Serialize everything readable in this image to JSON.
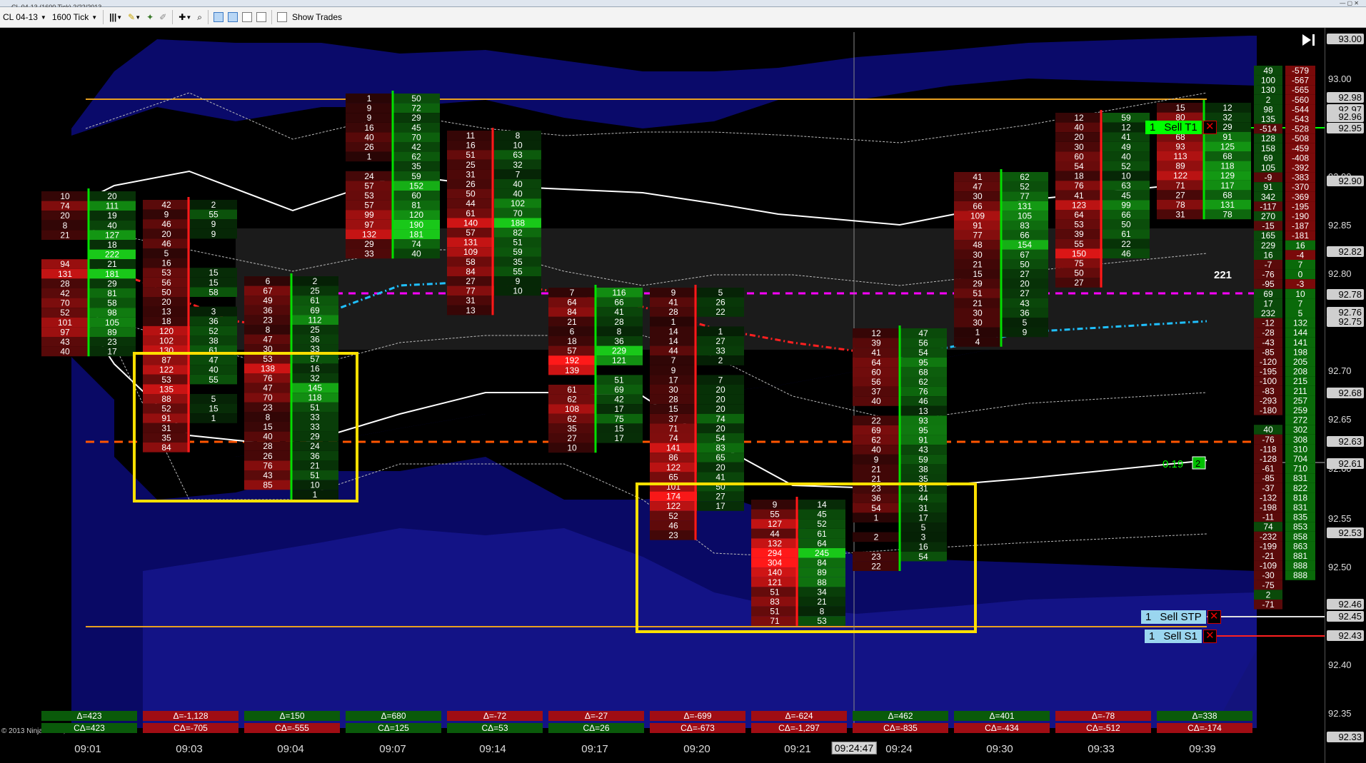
{
  "window": {
    "title": "CL 04-13 (1600 Tick)  2/22/2013"
  },
  "toolbar": {
    "instrument": "CL 04-13",
    "period": "1600 Tick",
    "show_trades": "Show Trades"
  },
  "colors": {
    "bg": "#000000",
    "buy": "#00c000",
    "sell": "#ff2020",
    "band": "#101070",
    "highlight": "#ffe000"
  },
  "price_axis": {
    "ticks": [
      "93.00",
      "92.95",
      "92.90",
      "92.85",
      "92.80",
      "92.75",
      "92.70",
      "92.65",
      "92.60",
      "92.55",
      "92.50",
      "92.45",
      "92.40",
      "92.35"
    ],
    "labels": [
      "93.00",
      "92.98",
      "92.97",
      "92.96",
      "92.95",
      "92.90",
      "92.82",
      "92.78",
      "92.76",
      "92.75",
      "92.68",
      "92.63",
      "92.61",
      "92.53",
      "92.46",
      "92.45",
      "92.43",
      "92.33"
    ]
  },
  "time_axis": {
    "labels": [
      "09:01",
      "09:03",
      "09:04",
      "09:07",
      "09:14",
      "09:17",
      "09:20",
      "09:21",
      "09:24",
      "09:30",
      "09:33",
      "09:39"
    ],
    "cursor": "09:24:47"
  },
  "copyright": "© 2013 NinjaTrader, LLC",
  "deltas": [
    {
      "d": "Δ=423",
      "cd": "CΔ=423",
      "pos": true,
      "cpos": true
    },
    {
      "d": "Δ=-1,128",
      "cd": "CΔ=-705",
      "pos": false,
      "cpos": false
    },
    {
      "d": "Δ=150",
      "cd": "CΔ=-555",
      "pos": true,
      "cpos": false
    },
    {
      "d": "Δ=680",
      "cd": "CΔ=125",
      "pos": true,
      "cpos": true
    },
    {
      "d": "Δ=-72",
      "cd": "CΔ=53",
      "pos": false,
      "cpos": true
    },
    {
      "d": "Δ=-27",
      "cd": "CΔ=26",
      "pos": false,
      "cpos": true
    },
    {
      "d": "Δ=-699",
      "cd": "CΔ=-673",
      "pos": false,
      "cpos": false
    },
    {
      "d": "Δ=-624",
      "cd": "CΔ=-1,297",
      "pos": false,
      "cpos": false
    },
    {
      "d": "Δ=462",
      "cd": "CΔ=-835",
      "pos": true,
      "cpos": false
    },
    {
      "d": "Δ=401",
      "cd": "CΔ=-434",
      "pos": true,
      "cpos": false
    },
    {
      "d": "Δ=-78",
      "cd": "CΔ=-512",
      "pos": false,
      "cpos": false
    },
    {
      "d": "Δ=338",
      "cd": "CΔ=-174",
      "pos": true,
      "cpos": false
    }
  ],
  "orders": {
    "target": {
      "qty": "1",
      "label": "Sell T1"
    },
    "stop": {
      "qty": "1",
      "label": "Sell STP"
    },
    "s1": {
      "qty": "1",
      "label": "Sell S1"
    }
  },
  "position_pnl": "0.19",
  "position_qty": "2",
  "volume_note": "221",
  "bars": [
    {
      "bid": [
        "10",
        "74",
        "20",
        "8",
        "21",
        "",
        "",
        "94",
        "131",
        "28",
        "42",
        "70",
        "52",
        "101",
        "97",
        "43",
        "40"
      ],
      "ask": [
        "20",
        "111",
        "19",
        "40",
        "127",
        "18",
        "222",
        "21",
        "181",
        "29",
        "81",
        "58",
        "98",
        "105",
        "89",
        "23",
        "17"
      ]
    },
    {
      "bid": [
        "42",
        "9",
        "46",
        "20",
        "46",
        "5",
        "16",
        "53",
        "56",
        "50",
        "20",
        "13",
        "18",
        "120",
        "102",
        "130",
        "87",
        "122",
        "53",
        "135",
        "88",
        "52",
        "91",
        "31",
        "35",
        "84"
      ],
      "ask": [
        "2",
        "55",
        "9",
        "9",
        "",
        "",
        "",
        "15",
        "15",
        "58",
        "",
        "3",
        "36",
        "52",
        "38",
        "61",
        "47",
        "40",
        "55",
        "",
        "5",
        "15",
        "1"
      ]
    },
    {
      "bid": [
        "6",
        "67",
        "49",
        "36",
        "23",
        "8",
        "47",
        "30",
        "53",
        "138",
        "76",
        "47",
        "70",
        "23",
        "8",
        "15",
        "40",
        "28",
        "26",
        "76",
        "43",
        "85"
      ],
      "ask": [
        "2",
        "25",
        "61",
        "69",
        "112",
        "25",
        "36",
        "33",
        "57",
        "16",
        "32",
        "145",
        "118",
        "51",
        "33",
        "33",
        "29",
        "24",
        "36",
        "21",
        "51",
        "10",
        "1"
      ]
    },
    {
      "bid": [
        "1",
        "9",
        "9",
        "16",
        "40",
        "26",
        "1",
        "",
        "24",
        "57",
        "53",
        "57",
        "99",
        "97",
        "132",
        "29",
        "33"
      ],
      "ask": [
        "50",
        "72",
        "29",
        "45",
        "70",
        "42",
        "62",
        "35",
        "59",
        "152",
        "60",
        "81",
        "120",
        "190",
        "181",
        "74",
        "40"
      ]
    },
    {
      "bid": [
        "11",
        "16",
        "51",
        "25",
        "31",
        "26",
        "50",
        "44",
        "61",
        "140",
        "57",
        "131",
        "109",
        "58",
        "84",
        "27",
        "77",
        "31",
        "13"
      ],
      "ask": [
        "8",
        "10",
        "63",
        "32",
        "7",
        "40",
        "40",
        "102",
        "70",
        "188",
        "82",
        "51",
        "59",
        "35",
        "55",
        "9",
        "10"
      ]
    },
    {
      "bid": [
        "7",
        "64",
        "84",
        "21",
        "6",
        "18",
        "57",
        "192",
        "139",
        "",
        "61",
        "62",
        "108",
        "62",
        "35",
        "27",
        "10"
      ],
      "ask": [
        "116",
        "66",
        "41",
        "28",
        "8",
        "36",
        "229",
        "121",
        "",
        "51",
        "69",
        "42",
        "17",
        "75",
        "15",
        "17"
      ]
    },
    {
      "bid": [
        "9",
        "41",
        "28",
        "1",
        "14",
        "14",
        "44",
        "7",
        "9",
        "17",
        "30",
        "28",
        "15",
        "37",
        "71",
        "74",
        "141",
        "86",
        "122",
        "65",
        "101",
        "174",
        "122",
        "52",
        "46",
        "23"
      ],
      "ask": [
        "5",
        "26",
        "22",
        "",
        "1",
        "27",
        "33",
        "2",
        "",
        "7",
        "20",
        "20",
        "20",
        "74",
        "20",
        "54",
        "83",
        "65",
        "20",
        "41",
        "50",
        "27",
        "17"
      ]
    },
    {
      "bid": [
        "9",
        "55",
        "127",
        "44",
        "132",
        "294",
        "304",
        "140",
        "121",
        "51",
        "83",
        "51",
        "71"
      ],
      "ask": [
        "14",
        "45",
        "52",
        "61",
        "64",
        "245",
        "84",
        "89",
        "88",
        "34",
        "21",
        "8",
        "53"
      ]
    },
    {
      "bid": [
        "12",
        "39",
        "41",
        "64",
        "60",
        "56",
        "37",
        "40",
        "",
        "22",
        "69",
        "62",
        "40",
        "9",
        "21",
        "21",
        "23",
        "36",
        "54",
        "1",
        "",
        "2",
        "",
        "23",
        "22"
      ],
      "ask": [
        "47",
        "56",
        "54",
        "95",
        "68",
        "62",
        "76",
        "46",
        "13",
        "93",
        "95",
        "91",
        "43",
        "59",
        "38",
        "35",
        "31",
        "44",
        "31",
        "17",
        "5",
        "3",
        "16",
        "54"
      ]
    },
    {
      "bid": [
        "41",
        "47",
        "30",
        "66",
        "109",
        "91",
        "77",
        "48",
        "30",
        "21",
        "15",
        "29",
        "51",
        "21",
        "30",
        "30",
        "1",
        "4"
      ],
      "ask": [
        "62",
        "52",
        "77",
        "131",
        "105",
        "83",
        "66",
        "154",
        "67",
        "50",
        "27",
        "20",
        "27",
        "43",
        "36",
        "5",
        "9"
      ]
    },
    {
      "bid": [
        "12",
        "40",
        "20",
        "30",
        "60",
        "54",
        "18",
        "76",
        "41",
        "123",
        "64",
        "53",
        "39",
        "55",
        "150",
        "75",
        "50",
        "27"
      ],
      "ask": [
        "59",
        "12",
        "41",
        "49",
        "40",
        "52",
        "10",
        "63",
        "45",
        "99",
        "66",
        "50",
        "61",
        "22",
        "46"
      ]
    },
    {
      "bid": [
        "15",
        "80",
        "51",
        "68",
        "93",
        "113",
        "89",
        "122",
        "71",
        "27",
        "78",
        "31"
      ],
      "ask": [
        "12",
        "32",
        "29",
        "91",
        "125",
        "68",
        "118",
        "129",
        "117",
        "68",
        "131",
        "78"
      ]
    }
  ],
  "right_column": {
    "left": [
      "49",
      "100",
      "130",
      "2",
      "98",
      "135",
      "-514",
      "128",
      "158",
      "69",
      "105",
      "-9",
      "91",
      "342",
      "-117",
      "270",
      "-15",
      "165",
      "229",
      "16",
      "-7",
      "-76",
      "-95",
      "69",
      "17",
      "232",
      "-12",
      "-28",
      "-43",
      "-85",
      "-120",
      "-195",
      "-100",
      "-83",
      "-293",
      "-180",
      "",
      "40",
      "-76",
      "-118",
      "-128",
      "-61",
      "-85",
      "-37",
      "-132",
      "-198",
      "-11",
      "74",
      "-232",
      "-199",
      "-21",
      "-109",
      "-30",
      "-75",
      "2",
      "-71"
    ],
    "right": [
      "-579",
      "-567",
      "-565",
      "-560",
      "-544",
      "-543",
      "-528",
      "-508",
      "-459",
      "-408",
      "-392",
      "-383",
      "-370",
      "-369",
      "-195",
      "-190",
      "-187",
      "-181",
      "16",
      "-4",
      "7",
      "0",
      "-3",
      "10",
      "7",
      "5",
      "132",
      "144",
      "141",
      "198",
      "205",
      "208",
      "215",
      "211",
      "257",
      "259",
      "272",
      "302",
      "308",
      "310",
      "704",
      "710",
      "831",
      "822",
      "818",
      "831",
      "835",
      "853",
      "858",
      "863",
      "881",
      "888",
      "888"
    ]
  }
}
